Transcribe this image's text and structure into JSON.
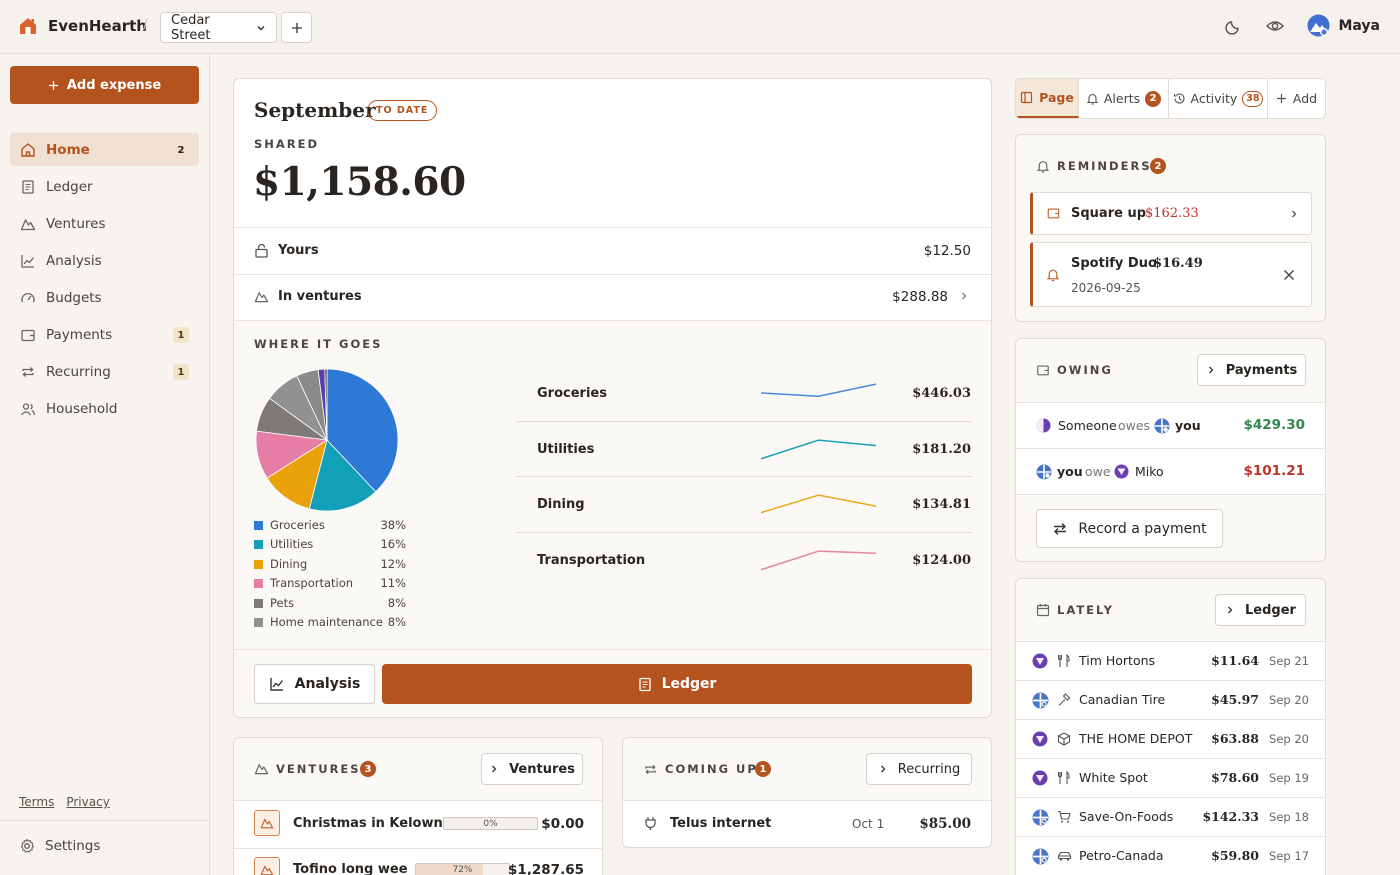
{
  "app": {
    "name": "EvenHearth",
    "project": "Cedar Street",
    "user": "Maya"
  },
  "sidebar": {
    "add_label": "Add expense",
    "items": [
      {
        "label": "Home",
        "badge": "2"
      },
      {
        "label": "Ledger",
        "badge": ""
      },
      {
        "label": "Ventures",
        "badge": ""
      },
      {
        "label": "Analysis",
        "badge": ""
      },
      {
        "label": "Budgets",
        "badge": ""
      },
      {
        "label": "Payments",
        "badge": "1"
      },
      {
        "label": "Recurring",
        "badge": "1"
      },
      {
        "label": "Household",
        "badge": ""
      }
    ],
    "terms": "Terms",
    "privacy": "Privacy",
    "settings": "Settings"
  },
  "summary": {
    "month": "September",
    "period_badge": "TO DATE",
    "shared_label": "SHARED",
    "shared_amount": "$1,158.60",
    "yours_label": "Yours",
    "yours_amount": "$12.50",
    "ventures_label": "In ventures",
    "ventures_amount": "$288.88",
    "where_label": "WHERE IT GOES",
    "analysis_btn": "Analysis",
    "ledger_btn": "Ledger"
  },
  "chart_data": {
    "type": "pie",
    "slices": [
      {
        "label": "Groceries",
        "pct": 38,
        "color": "#2e78d6"
      },
      {
        "label": "Utilities",
        "pct": 16,
        "color": "#12a0b8"
      },
      {
        "label": "Dining",
        "pct": 12,
        "color": "#eaa20c"
      },
      {
        "label": "Transportation",
        "pct": 11,
        "color": "#e77ea6"
      },
      {
        "label": "Pets",
        "pct": 8,
        "color": "#7d7a77"
      },
      {
        "label": "Home maintenance",
        "pct": 8,
        "color": "#919191"
      },
      {
        "label": "",
        "pct": 5,
        "color": "#8a8a88"
      },
      {
        "label": "",
        "pct": 1.5,
        "color": "#5b3fa8"
      },
      {
        "label": "",
        "pct": 0.5,
        "color": "#3a3a38"
      }
    ]
  },
  "trends": [
    {
      "label": "Groceries",
      "amount": "$446.03",
      "color": "#4a8ad8",
      "points": [
        0.55,
        0.4,
        0.95
      ]
    },
    {
      "label": "Utilities",
      "amount": "$181.20",
      "color": "#1aa2b6",
      "points": [
        0.1,
        0.95,
        0.7
      ]
    },
    {
      "label": "Dining",
      "amount": "$134.81",
      "color": "#e6a91a",
      "points": [
        0.15,
        0.95,
        0.45
      ]
    },
    {
      "label": "Transportation",
      "amount": "$124.00",
      "color": "#e784a8",
      "points": [
        0.1,
        0.95,
        0.85
      ]
    }
  ],
  "ventures": {
    "title": "VENTURES",
    "count": "3",
    "link": "Ventures",
    "items": [
      {
        "name": "Christmas in Kelowna",
        "progress": 0,
        "progress_label": "0%",
        "amount": "$0.00"
      },
      {
        "name": "Tofino long weeke",
        "progress": 0.72,
        "progress_label": "72%",
        "amount": "$1,287.65"
      }
    ]
  },
  "coming_up": {
    "title": "COMING UP",
    "count": "1",
    "link": "Recurring",
    "items": [
      {
        "name": "Telus internet",
        "date": "Oct 1",
        "amount": "$85.00"
      }
    ]
  },
  "tabs": [
    {
      "label": "Page",
      "badge": ""
    },
    {
      "label": "Alerts",
      "badge": "2"
    },
    {
      "label": "Activity",
      "badge": "38"
    },
    {
      "label": "Add",
      "badge": ""
    }
  ],
  "reminders": {
    "title": "REMINDERS",
    "count": "2",
    "items": [
      {
        "title": "Square up",
        "amount": "$162.33",
        "sub": ""
      },
      {
        "title": "Spotify Duo",
        "amount": "$16.49",
        "sub": "2026-09-25"
      }
    ]
  },
  "owing": {
    "title": "OWING",
    "link": "Payments",
    "rows": [
      {
        "from": "Someone",
        "verb": "owes",
        "to": "you",
        "amount": "$429.30",
        "color": "#2f8a4a"
      },
      {
        "from": "you",
        "verb": "owe",
        "to": "Miko",
        "amount": "$101.21",
        "color": "#c0332b"
      }
    ],
    "record_btn": "Record a payment"
  },
  "lately": {
    "title": "LATELY",
    "link": "Ledger",
    "rows": [
      {
        "avatar": "purple",
        "icon": "fork-knife-icon",
        "name": "Tim Hortons",
        "amount": "$11.64",
        "date": "Sep 21"
      },
      {
        "avatar": "blue",
        "icon": "hammer-icon",
        "name": "Canadian Tire",
        "amount": "$45.97",
        "date": "Sep 20"
      },
      {
        "avatar": "purple",
        "icon": "box-icon",
        "name": "THE HOME DEPOT",
        "amount": "$63.88",
        "date": "Sep 20"
      },
      {
        "avatar": "purple",
        "icon": "fork-knife-icon",
        "name": "White Spot",
        "amount": "$78.60",
        "date": "Sep 19"
      },
      {
        "avatar": "blue",
        "icon": "cart-icon",
        "name": "Save-On-Foods",
        "amount": "$142.33",
        "date": "Sep 18"
      },
      {
        "avatar": "blue",
        "icon": "car-icon",
        "name": "Petro-Canada",
        "amount": "$59.80",
        "date": "Sep 17"
      }
    ]
  }
}
